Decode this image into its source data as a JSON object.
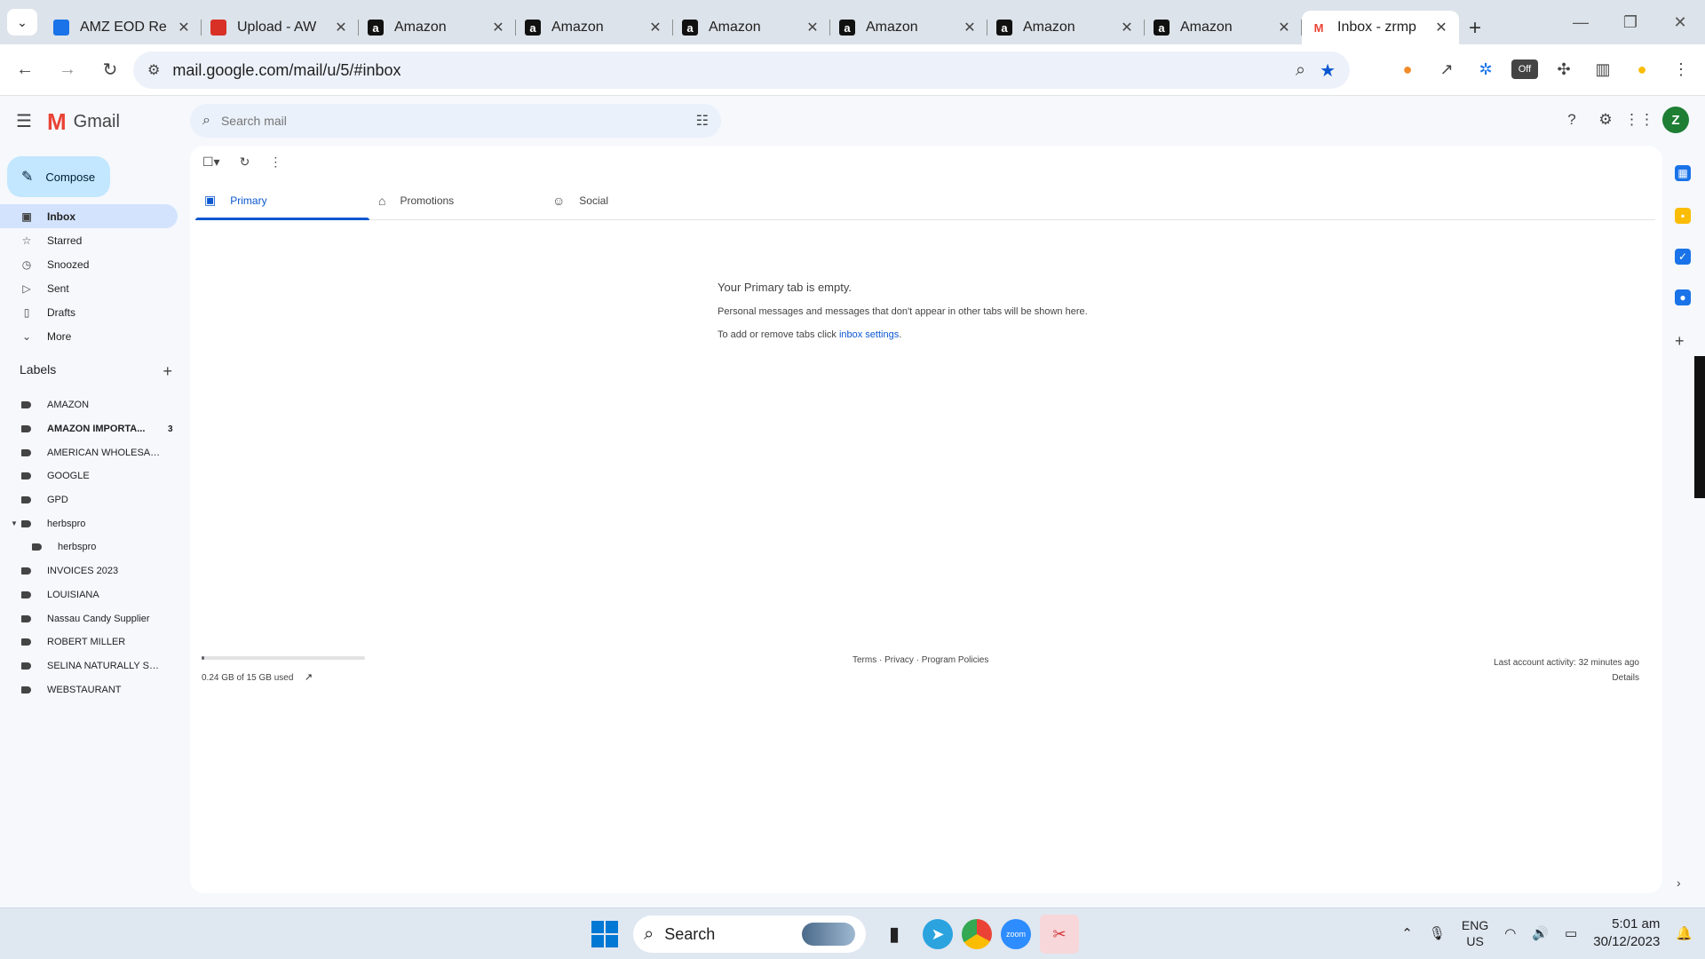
{
  "browser": {
    "tabs": [
      {
        "title": "AMZ EOD Re",
        "icon": "sheets-icon",
        "color": "#1a73e8"
      },
      {
        "title": "Upload - AW",
        "icon": "aw-icon",
        "color": "#d93025"
      },
      {
        "title": "Amazon",
        "icon": "amazon-icon",
        "color": "#111111"
      },
      {
        "title": "Amazon",
        "icon": "amazon-icon",
        "color": "#111111"
      },
      {
        "title": "Amazon",
        "icon": "amazon-icon",
        "color": "#111111"
      },
      {
        "title": "Amazon",
        "icon": "amazon-icon",
        "color": "#111111"
      },
      {
        "title": "Amazon",
        "icon": "amazon-icon",
        "color": "#111111"
      },
      {
        "title": "Amazon",
        "icon": "amazon-icon",
        "color": "#111111"
      },
      {
        "title": "Inbox - zrmp",
        "icon": "gmail-icon",
        "color": "#ea4335",
        "active": true
      }
    ],
    "url": "mail.google.com/mail/u/5/#inbox"
  },
  "gmail": {
    "app_name": "Gmail",
    "search_placeholder": "Search mail",
    "avatar_letter": "Z",
    "compose_label": "Compose",
    "nav": [
      {
        "label": "Inbox",
        "icon": "inbox-icon",
        "active": true
      },
      {
        "label": "Starred",
        "icon": "star-icon"
      },
      {
        "label": "Snoozed",
        "icon": "clock-icon"
      },
      {
        "label": "Sent",
        "icon": "send-icon"
      },
      {
        "label": "Drafts",
        "icon": "draft-icon"
      },
      {
        "label": "More",
        "icon": "chevron-down-icon"
      }
    ],
    "labels_heading": "Labels",
    "labels": [
      {
        "name": "AMAZON"
      },
      {
        "name": "AMAZON IMPORTA...",
        "count": "3",
        "bold": true
      },
      {
        "name": "AMERICAN WHOLESALER"
      },
      {
        "name": "GOOGLE"
      },
      {
        "name": "GPD"
      },
      {
        "name": "herbspro",
        "expanded": true
      },
      {
        "name": "herbspro",
        "sub": true
      },
      {
        "name": "INVOICES 2023"
      },
      {
        "name": "LOUISIANA"
      },
      {
        "name": "Nassau Candy Supplier"
      },
      {
        "name": "ROBERT MILLER"
      },
      {
        "name": "SELINA NATURALLY SU..."
      },
      {
        "name": "WEBSTAURANT"
      }
    ],
    "tabs": [
      {
        "label": "Primary",
        "icon": "inbox-icon",
        "active": true
      },
      {
        "label": "Promotions",
        "icon": "tag-icon"
      },
      {
        "label": "Social",
        "icon": "people-icon"
      }
    ],
    "empty": {
      "heading": "Your Primary tab is empty.",
      "line1": "Personal messages and messages that don't appear in other tabs will be shown here.",
      "line2_prefix": "To add or remove tabs click ",
      "line2_link": "inbox settings",
      "line2_suffix": "."
    },
    "footer": {
      "storage_text": "0.24 GB of 15 GB used",
      "storage_fraction": 0.016,
      "policies": "Terms · Privacy · Program Policies",
      "activity": "Last account activity: 32 minutes ago",
      "details": "Details"
    }
  },
  "taskbar": {
    "search_label": "Search",
    "lang": "ENG",
    "region": "US",
    "time": "5:01 am",
    "date": "30/12/2023"
  }
}
